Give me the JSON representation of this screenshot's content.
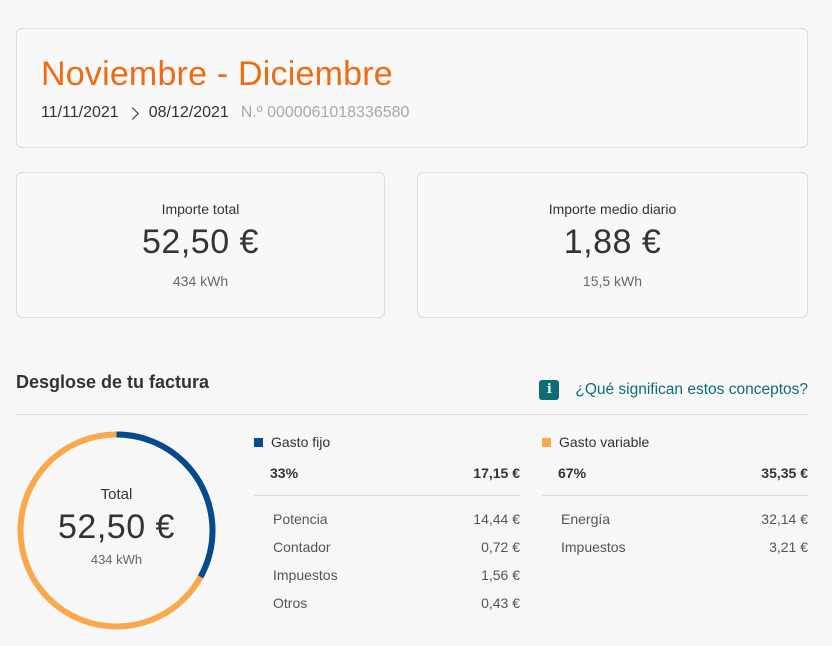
{
  "period": {
    "title": "Noviembre - Diciembre",
    "start_date": "11/11/2021",
    "end_date": "08/12/2021",
    "invoice_number": "N.º 0000061018336580"
  },
  "summary": {
    "total": {
      "label": "Importe total",
      "value": "52,50 €",
      "kwh": "434 kWh"
    },
    "daily": {
      "label": "Importe medio diario",
      "value": "1,88 €",
      "kwh": "15,5 kWh"
    }
  },
  "breakdown": {
    "title": "Desglose de tu factura",
    "info_icon": "i",
    "info_link": "¿Qué significan estos conceptos?",
    "donut": {
      "label": "Total",
      "value": "52,50 €",
      "kwh": "434 kWh",
      "segments": [
        {
          "name": "Gasto fijo",
          "fraction": 0.33,
          "color": "#034b8f"
        },
        {
          "name": "Gasto variable",
          "fraction": 0.67,
          "color": "#f9a94b"
        }
      ]
    },
    "fixed": {
      "label": "Gasto fijo",
      "color": "#034b8f",
      "percent": "33%",
      "amount": "17,15 €",
      "items": [
        {
          "label": "Potencia",
          "value": "14,44 €"
        },
        {
          "label": "Contador",
          "value": "0,72 €"
        },
        {
          "label": "Impuestos",
          "value": "1,56 €"
        },
        {
          "label": "Otros",
          "value": "0,43 €"
        }
      ]
    },
    "variable": {
      "label": "Gasto variable",
      "color": "#f9a94b",
      "percent": "67%",
      "amount": "35,35 €",
      "items": [
        {
          "label": "Energía",
          "value": "32,14 €"
        },
        {
          "label": "Impuestos",
          "value": "3,21 €"
        }
      ]
    }
  }
}
